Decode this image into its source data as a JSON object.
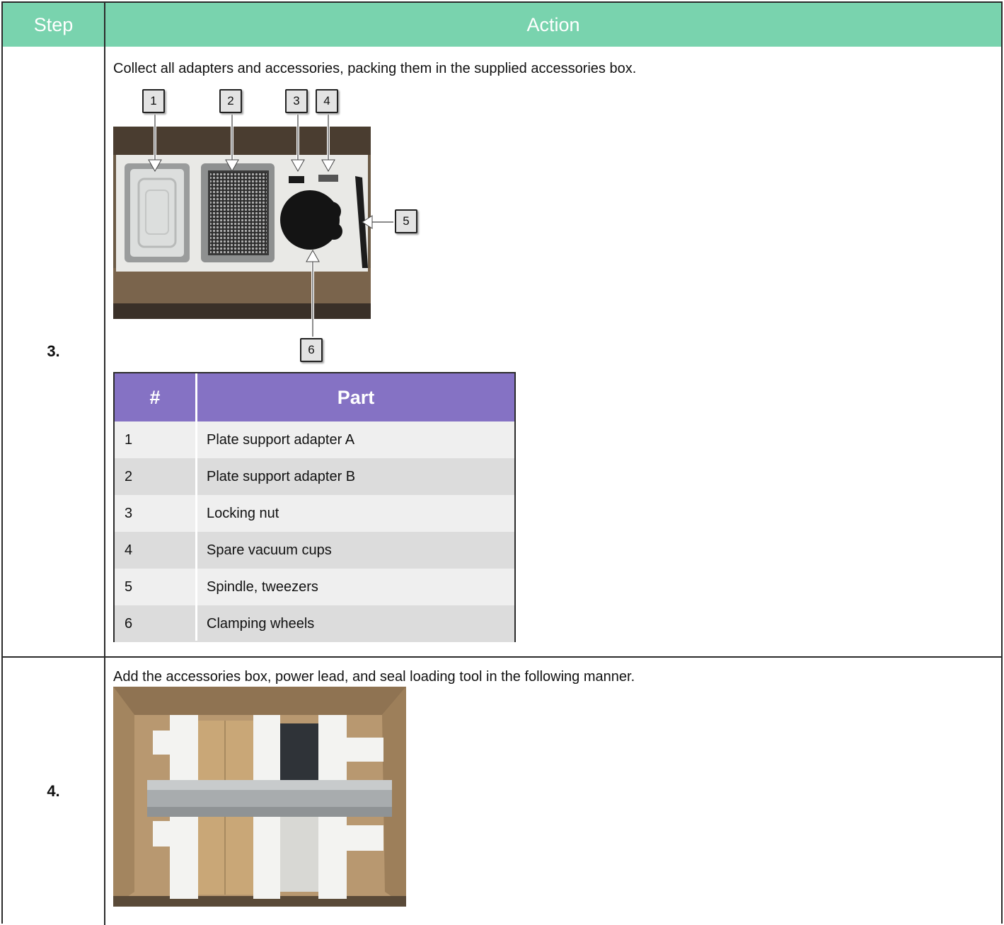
{
  "table": {
    "header": {
      "step": "Step",
      "action": "Action"
    },
    "rows": [
      {
        "step": "3.",
        "instruction": "Collect all adapters and accessories, packing them in the supplied accessories box.",
        "callouts": [
          "1",
          "2",
          "3",
          "4",
          "5",
          "6"
        ],
        "parts_table": {
          "header": {
            "num": "#",
            "part": "Part"
          },
          "rows": [
            {
              "num": "1",
              "part": "Plate support adapter A"
            },
            {
              "num": "2",
              "part": "Plate support adapter B"
            },
            {
              "num": "3",
              "part": "Locking nut"
            },
            {
              "num": "4",
              "part": "Spare vacuum cups"
            },
            {
              "num": "5",
              "part": "Spindle, tweezers"
            },
            {
              "num": "6",
              "part": "Clamping wheels"
            }
          ]
        }
      },
      {
        "step": "4.",
        "instruction": "Add the accessories box, power lead, and seal loading tool in the following manner."
      }
    ]
  },
  "colors": {
    "header_green": "#79d3ae",
    "parts_header_purple": "#8572c4",
    "row_light": "#efefef",
    "row_dark": "#dcdcdc",
    "border": "#2b2b2b"
  }
}
